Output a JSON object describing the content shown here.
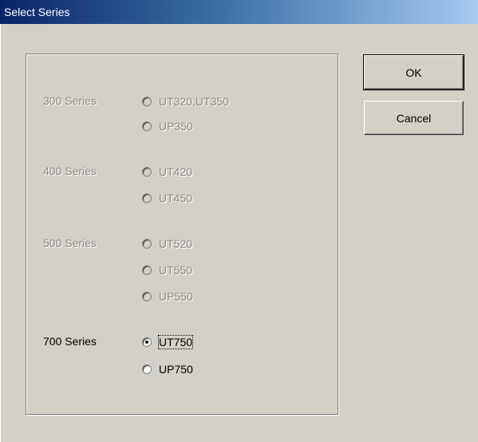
{
  "window": {
    "title": "Select Series"
  },
  "groups": [
    {
      "label": "300 Series",
      "enabled": false,
      "options": [
        "UT320,UT350",
        "UP350"
      ]
    },
    {
      "label": "400 Series",
      "enabled": false,
      "options": [
        "UT420",
        "UT450"
      ]
    },
    {
      "label": "500 Series",
      "enabled": false,
      "options": [
        "UT520",
        "UT550",
        "UP550"
      ]
    },
    {
      "label": "700 Series",
      "enabled": true,
      "options": [
        "UT750",
        "UP750"
      ]
    }
  ],
  "selected_option": "UT750",
  "buttons": {
    "ok_label": "OK",
    "cancel_label": "Cancel"
  }
}
